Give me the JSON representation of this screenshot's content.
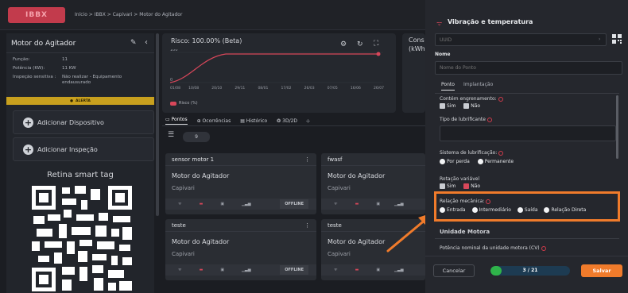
{
  "topbar": {
    "logo": "IBBX",
    "breadcrumb": "Início  >  IBBX  >  Capivari  >  Motor do Agitador"
  },
  "sidebar": {
    "title": "Motor do Agitador",
    "fields": [
      {
        "label": "Função:",
        "value": "11"
      },
      {
        "label": "Potência (KW):",
        "value": "11 KW"
      },
      {
        "label": "Inspeção sensitiva :",
        "value": "Não realizar - Equipamento endausurado"
      }
    ],
    "status_badge": "ALERTA",
    "add_device": "Adicionar Dispositivo",
    "add_inspection": "Adicionar Inspeção",
    "qr_title": "Retina smart tag"
  },
  "risk": {
    "title": "Risco: 100.00% (Beta)",
    "y_top": "100",
    "y_bottom": "0",
    "x_labels": [
      "01/08",
      "10/08",
      "20/10",
      "29/11",
      "08/01",
      "17/02",
      "26/03",
      "07/05",
      "16/06",
      "26/07"
    ],
    "legend": "Risco (%)",
    "line_color": "#d8475a"
  },
  "consumo": {
    "title": "Cons",
    "subtitle": "(kWh"
  },
  "tabs": [
    {
      "label": "Pontos"
    },
    {
      "label": "Ocorrências"
    },
    {
      "label": "Histórico"
    },
    {
      "label": "3D/2D"
    }
  ],
  "tab_add": "+",
  "search_value": "9",
  "cards": [
    {
      "name": "sensor motor 1",
      "asset": "Motor do Agitador",
      "site": "Capivari",
      "status": "OFFLINE"
    },
    {
      "name": "fwasf",
      "asset": "Motor do Agitador",
      "site": "Capivari",
      "status": ""
    },
    {
      "name": "teste",
      "asset": "Motor do Agitador",
      "site": "Capivari",
      "status": "OFFLINE"
    },
    {
      "name": "teste",
      "asset": "Motor do Agitador",
      "site": "Capivari",
      "status": ""
    }
  ],
  "modal": {
    "title": "Vibração e temperatura",
    "uuid_placeholder": "UUID",
    "name_label": "Nome",
    "name_placeholder": "Nome do Ponto",
    "tabs": [
      "Ponto",
      "Implantação"
    ],
    "gear_label": "Contém engrenamento:",
    "yes": "Sim",
    "no": "Não",
    "lub_type_label": "Tipo de lubrificante",
    "lub_system_label": "Sistema de lubrificação:",
    "lub_options": [
      "Por perda",
      "Permanente"
    ],
    "var_rot_label": "Rotação variável",
    "mech_label": "Relação mecânica:",
    "mech_options": [
      "Entrada",
      "Intermediário",
      "Saída",
      "Relação Direta"
    ],
    "motor_section": "Unidade Motora",
    "motor_power_label": "Potência nominal da unidade motora (CV)",
    "cancel": "Cancelar",
    "progress_text": "3 / 21",
    "progress_fraction": 0.143,
    "save": "Salvar",
    "accent": "#f07b2b",
    "progress_color": "#2fb34a"
  }
}
